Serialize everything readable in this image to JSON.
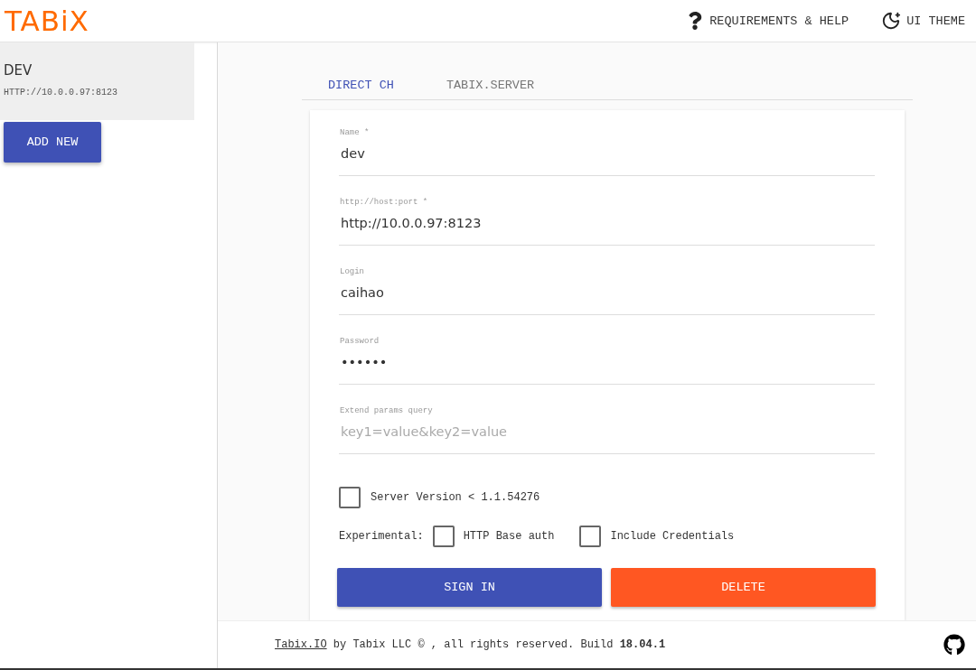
{
  "header": {
    "logo": "TABiX",
    "actions": [
      {
        "kind": "help",
        "label": "REQUIREMENTS & HELP"
      },
      {
        "kind": "theme",
        "label": "UI THEME"
      }
    ]
  },
  "sidebar": {
    "connections": [
      {
        "name": "DEV",
        "url": "HTTP://10.0.0.97:8123",
        "selected": true
      }
    ],
    "add_button": "ADD NEW"
  },
  "tabs": [
    {
      "label": "DIRECT CH",
      "selected": true
    },
    {
      "label": "TABIX.SERVER",
      "selected": false
    }
  ],
  "form": {
    "fields": [
      {
        "label": "Name *",
        "value": "dev"
      },
      {
        "label": "http://host:port *",
        "value": "http://10.0.0.97:8123"
      },
      {
        "label": "Login",
        "value": "caihao"
      },
      {
        "label": "Password",
        "value": "••••••"
      },
      {
        "label": "Extend params query",
        "placeholder": "key1=value&key2=value"
      }
    ],
    "server_version": {
      "label": "Server Version < 1.1.54276",
      "checked": false
    },
    "experimental_label": "Experimental:",
    "experimental": [
      {
        "label": "HTTP Base auth",
        "checked": false
      },
      {
        "label": "Include Credentials",
        "checked": false
      }
    ],
    "buttons": [
      {
        "kind": "primary",
        "label": "SIGN IN"
      },
      {
        "kind": "danger",
        "label": "DELETE"
      }
    ]
  },
  "footer": {
    "link": "Tabix.IO",
    "text": " by Tabix LLC © , all rights reserved. Build **18.04.1**"
  }
}
